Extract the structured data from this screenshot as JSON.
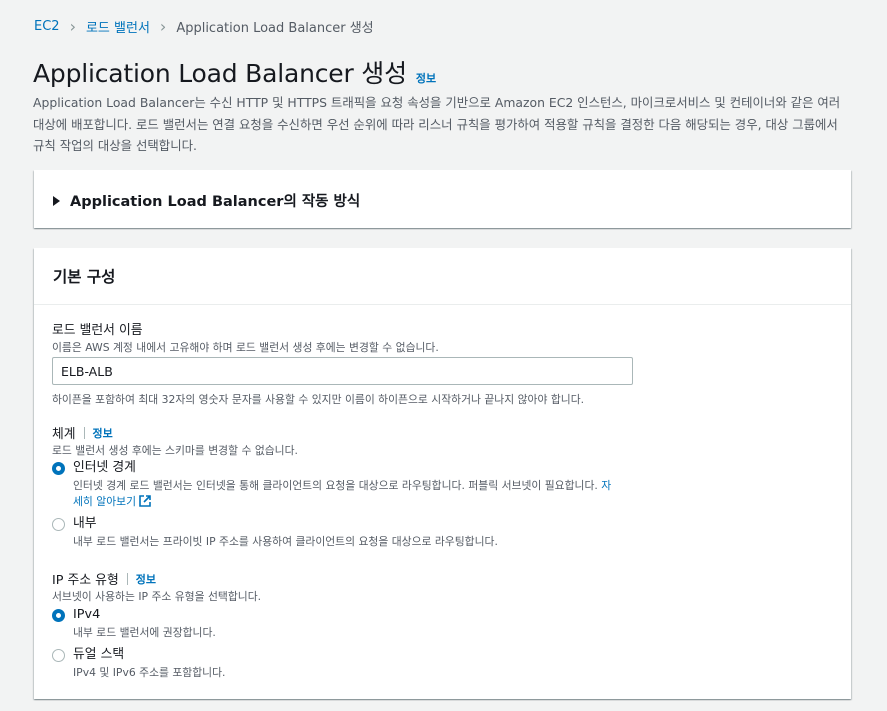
{
  "breadcrumb": {
    "items": [
      "EC2",
      "로드 밸런서"
    ],
    "current": "Application Load Balancer 생성"
  },
  "page": {
    "title": "Application Load Balancer 생성",
    "info": "정보",
    "description": "Application Load Balancer는 수신 HTTP 및 HTTPS 트래픽을 요청 속성을 기반으로 Amazon EC2 인스턴스, 마이크로서비스 및 컨테이너와 같은 여러 대상에 배포합니다. 로드 밸런서는 연결 요청을 수신하면 우선 순위에 따라 리스너 규칙을 평가하여 적용할 규칙을 결정한 다음 해당되는 경우, 대상 그룹에서 규칙 작업의 대상을 선택합니다."
  },
  "how_it_works": {
    "title": "Application Load Balancer의 작동 방식"
  },
  "basic": {
    "title": "기본 구성",
    "name_label": "로드 밸런서 이름",
    "name_desc": "이름은 AWS 계정 내에서 고유해야 하며 로드 밸런서 생성 후에는 변경할 수 없습니다.",
    "name_value": "ELB-ALB",
    "name_constraint": "하이픈을 포함하여 최대 32자의 영숫자 문자를 사용할 수 있지만 이름이 하이픈으로 시작하거나 끝나지 않아야 합니다.",
    "scheme_label": "체계",
    "scheme_info": "정보",
    "scheme_desc": "로드 밸런서 생성 후에는 스키마를 변경할 수 없습니다.",
    "scheme_options": [
      {
        "label": "인터넷 경계",
        "desc": "인터넷 경계 로드 밸런서는 인터넷을 통해 클라이언트의 요청을 대상으로 라우팅합니다. 퍼블릭 서브넷이 필요합니다.",
        "link": "자세히 알아보기",
        "selected": true
      },
      {
        "label": "내부",
        "desc": "내부 로드 밸런서는 프라이빗 IP 주소를 사용하여 클라이언트의 요청을 대상으로 라우팅합니다.",
        "selected": false
      }
    ],
    "ip_label": "IP 주소 유형",
    "ip_info": "정보",
    "ip_desc": "서브넷이 사용하는 IP 주소 유형을 선택합니다.",
    "ip_options": [
      {
        "label": "IPv4",
        "desc": "내부 로드 밸런서에 권장합니다.",
        "selected": true
      },
      {
        "label": "듀얼 스택",
        "desc": "IPv4 및 IPv6 주소를 포함합니다.",
        "selected": false
      }
    ]
  },
  "colors": {
    "link": "#0073bb",
    "background": "#f2f3f3",
    "text": "#16191f",
    "secondary_text": "#545b64"
  }
}
